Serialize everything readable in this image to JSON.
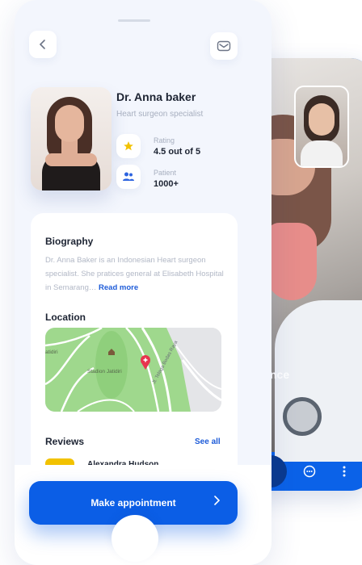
{
  "doctor": {
    "name": "Dr. Anna baker",
    "title": "Heart surgeon specialist",
    "rating_label": "Rating",
    "rating_value": "4.5 out of 5",
    "patient_label": "Patient",
    "patient_value": "1000+"
  },
  "biography": {
    "heading": "Biography",
    "text": "Dr. Anna Baker is an Indonesian Heart surgeon specialist. She pratices general at Elisabeth Hospital in Semarang…",
    "read_more": "Read more"
  },
  "location": {
    "heading": "Location",
    "place_label": "Stadion Jatidiri",
    "street_label": "Jl. Telaga Bodas Raya",
    "left_label": "atidiri",
    "bottom_left_label": "an Telaga Bodas Raya"
  },
  "reviews": {
    "heading": "Reviews",
    "see_all": "See all",
    "first_reviewer": "Alexandra Hudson"
  },
  "cta": {
    "label": "Make appointment"
  },
  "video_call": {
    "overlay_text": "nce"
  },
  "colors": {
    "accent": "#0b5ee6",
    "link": "#1d5bd8",
    "star": "#f2c200",
    "pin": "#e8344e",
    "map_green": "#9fd88d"
  },
  "icons": [
    "chevron-left-icon",
    "mail-icon",
    "star-icon",
    "users-icon",
    "map-pin-icon",
    "chevron-right-icon",
    "chat-icon",
    "more-vertical-icon"
  ]
}
